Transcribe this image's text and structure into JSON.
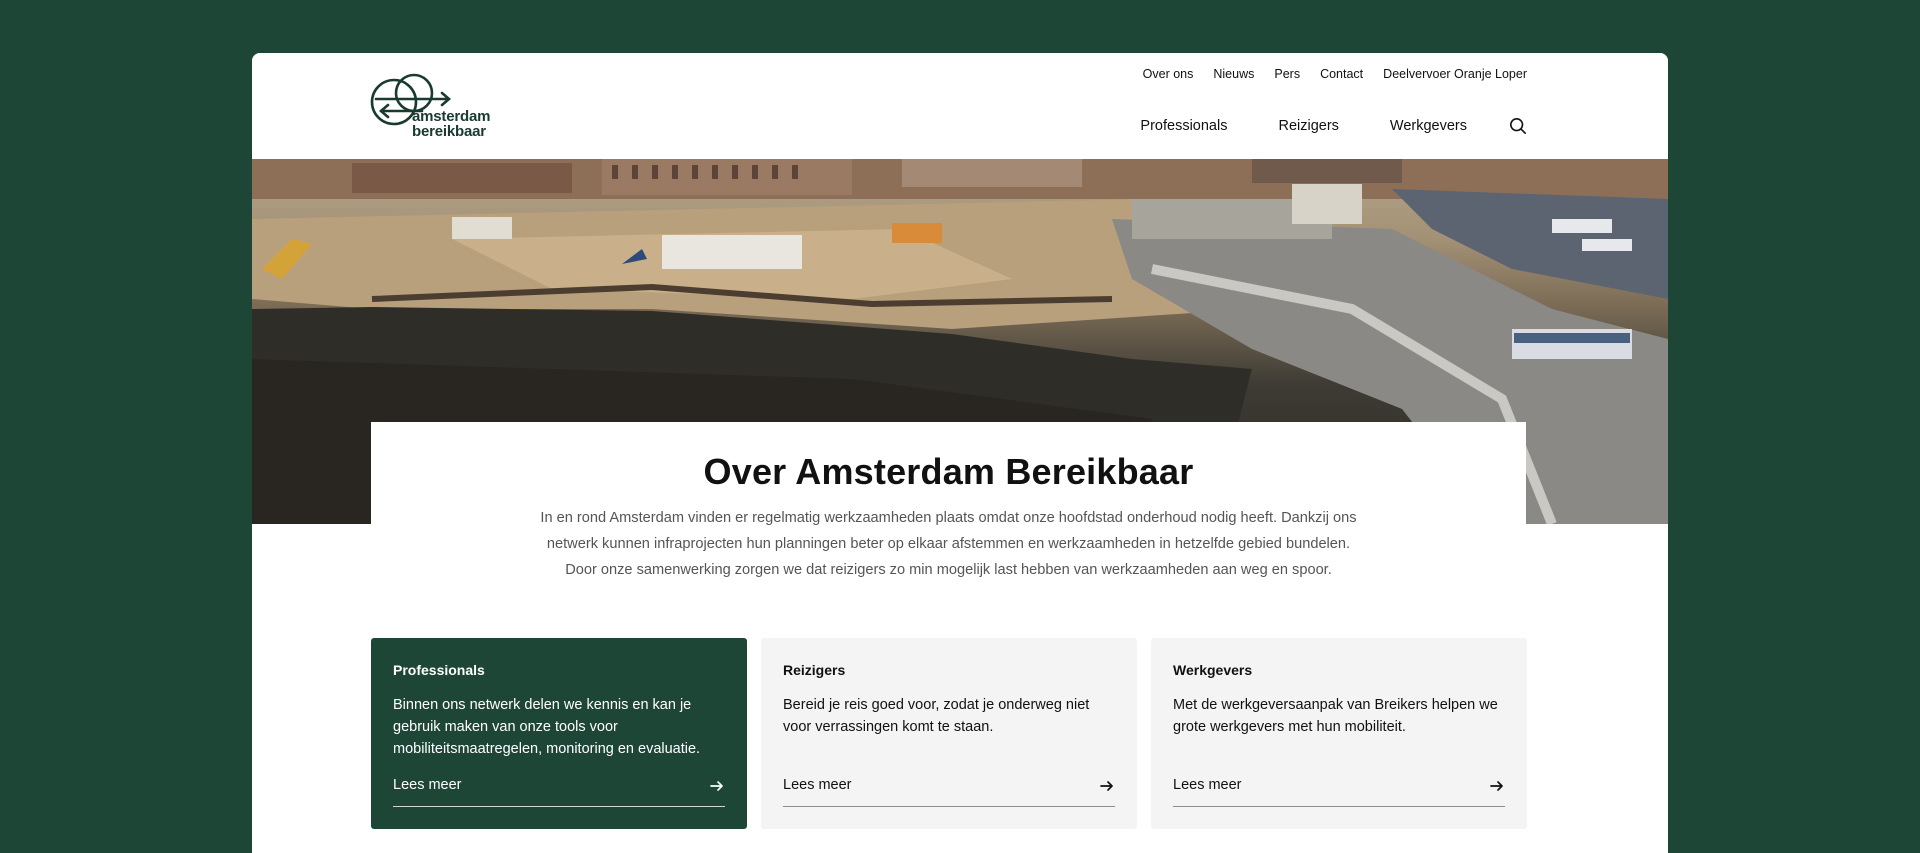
{
  "brand": {
    "logo_line1": "amsterdam",
    "logo_line2": "bereikbaar",
    "color_dark_green": "#1e4637",
    "color_logo": "#1a3a31"
  },
  "top_nav": {
    "items": [
      "Over ons",
      "Nieuws",
      "Pers",
      "Contact",
      "Deelvervoer Oranje Loper"
    ]
  },
  "main_nav": {
    "items": [
      "Professionals",
      "Reizigers",
      "Werkgevers"
    ],
    "search_icon": "search-icon"
  },
  "hero": {
    "image_description": "aerial-construction-amsterdam-centraal"
  },
  "intro": {
    "title": "Over Amsterdam Bereikbaar",
    "line1": "In en rond Amsterdam vinden er regelmatig werkzaamheden plaats omdat onze hoofdstad onderhoud nodig heeft. Dankzij ons",
    "line2": "netwerk kunnen infraprojecten hun planningen beter op elkaar afstemmen en werkzaamheden in hetzelfde gebied bundelen.",
    "line3": "Door onze samenwerking zorgen we dat reizigers zo min mogelijk last hebben van werkzaamheden aan weg en spoor."
  },
  "cards": [
    {
      "title": "Professionals",
      "text": "Binnen ons netwerk delen we kennis en kan je gebruik maken van onze tools voor mobiliteitsmaatregelen, monitoring en evaluatie.",
      "link": "Lees meer"
    },
    {
      "title": "Reizigers",
      "text": "Bereid je reis goed voor, zodat je onderweg niet voor verrassingen komt te staan.",
      "link": "Lees meer"
    },
    {
      "title": "Werkgevers",
      "text": "Met de werkgeversaanpak van Breikers helpen we grote werkgevers met hun mobiliteit.",
      "link": "Lees meer"
    }
  ]
}
